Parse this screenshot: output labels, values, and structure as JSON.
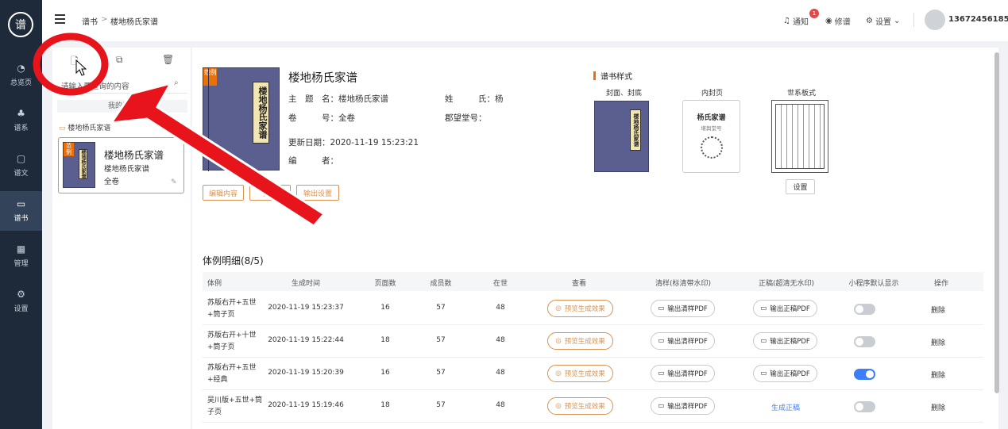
{
  "sidebar": {
    "logo": "谱",
    "items": [
      {
        "label": "总览页",
        "icon": "◔"
      },
      {
        "label": "谱系",
        "icon": "♣"
      },
      {
        "label": "谱文",
        "icon": "▢"
      },
      {
        "label": "谱书",
        "icon": "▭"
      },
      {
        "label": "管理",
        "icon": "▦"
      },
      {
        "label": "设置",
        "icon": "⚙"
      }
    ]
  },
  "header": {
    "crumb1": "谱书",
    "sep": ">",
    "crumb2": "楼地杨氏家谱",
    "notify": "通知",
    "notify_count": "1",
    "revise": "修谱",
    "settings": "设置",
    "user": "13672456185"
  },
  "left": {
    "search_placeholder": "请输入要查询的内容",
    "my_books": "我的谱书",
    "folder": "楼地杨氏家谱",
    "card": {
      "title": "楼地杨氏家谱",
      "sub": "楼地杨氏家谱",
      "vol": "全卷",
      "tag": "范例",
      "spine": "楼地杨氏家谱"
    }
  },
  "book": {
    "tag": "范例",
    "spine": "楼地杨氏家谱",
    "title": "楼地杨氏家谱",
    "f1": "主　题　名：楼地杨氏家谱",
    "f2": "姓　　　氏：杨",
    "f3": "卷　　　号：全卷",
    "f4": "郡望堂号：",
    "f5": "更新日期：2020-11-19 15:23:21",
    "f6": "编　　　者：",
    "btn_edit": "编辑内容",
    "btn_gen": "生成",
    "btn_output": "输出设置"
  },
  "styles": {
    "heading": "谱书样式",
    "cover_label": "封面、封底",
    "inner_label": "内封页",
    "tree_label": "世系板式",
    "inner_title": "杨氏家谱",
    "inner_sub": "堪舆堂号",
    "setting_btn": "设置",
    "cover_spine": "楼地杨氏家谱"
  },
  "details": {
    "heading": "体例明细(8/5)",
    "headers": [
      "体例",
      "生成时间",
      "页面数",
      "成员数",
      "在世",
      "查看",
      "清样(标清带水印)",
      "正稿(超清无水印)",
      "小程序默认显示",
      "操作"
    ],
    "rows": [
      {
        "style1": "苏版右开+五世",
        "style2": "+筒子页",
        "time": "2020-11-19 15:23:37",
        "pages": "16",
        "members": "57",
        "alive": "48",
        "view": "预览生成效果",
        "draft": "输出清样PDF",
        "final": "输出正稿PDF",
        "toggle": false,
        "op": "删除"
      },
      {
        "style1": "苏版右开+十世",
        "style2": "+筒子页",
        "time": "2020-11-19 15:22:44",
        "pages": "18",
        "members": "57",
        "alive": "48",
        "view": "预览生成效果",
        "draft": "输出清样PDF",
        "final": "输出正稿PDF",
        "toggle": false,
        "op": "删除"
      },
      {
        "style1": "苏版右开+五世",
        "style2": "+经典",
        "time": "2020-11-19 15:20:39",
        "pages": "16",
        "members": "57",
        "alive": "48",
        "view": "预览生成效果",
        "draft": "输出清样PDF",
        "final": "输出正稿PDF",
        "toggle": true,
        "op": "删除"
      },
      {
        "style1": "吴川版+五世+筒",
        "style2": "子页",
        "time": "2020-11-19 15:19:46",
        "pages": "18",
        "members": "57",
        "alive": "48",
        "view": "预览生成效果",
        "draft": "输出清样PDF",
        "final": "生成正稿",
        "toggle": false,
        "op": "删除"
      }
    ]
  },
  "colors": {
    "sidebar": "#1e2a3a",
    "accent": "#d9924f",
    "annotation": "#e8141c",
    "toggle_on": "#3c7ef6"
  }
}
